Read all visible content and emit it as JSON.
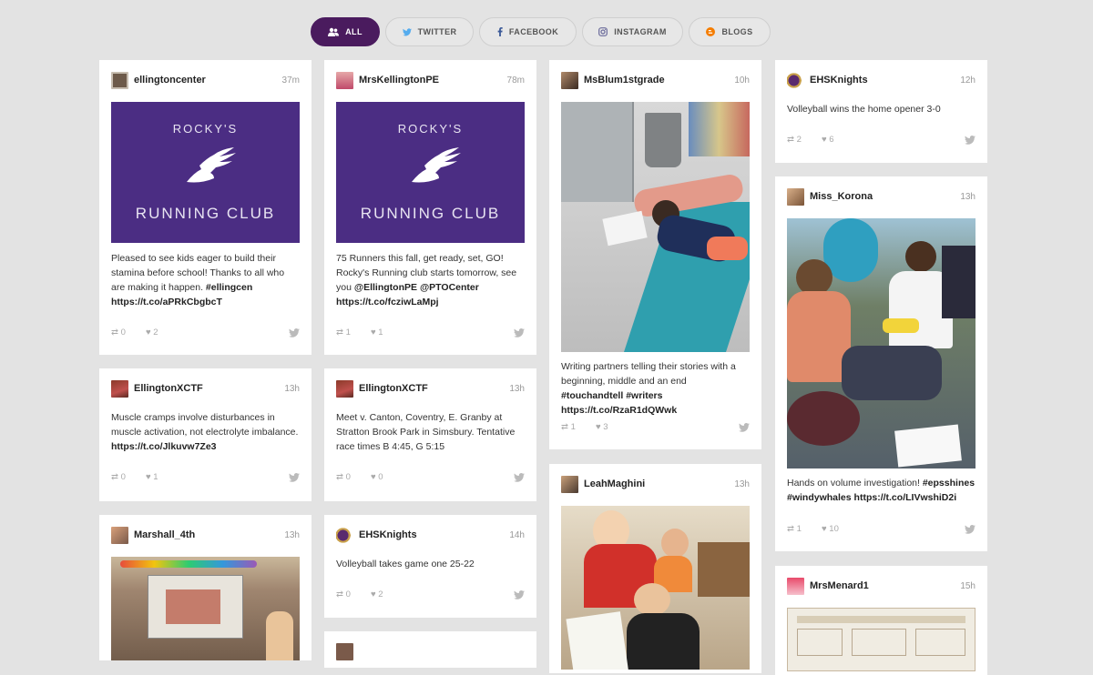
{
  "filters": [
    {
      "label": "ALL",
      "icon": "people-icon",
      "active": true
    },
    {
      "label": "TWITTER",
      "icon": "twitter-icon",
      "active": false
    },
    {
      "label": "FACEBOOK",
      "icon": "facebook-icon",
      "active": false
    },
    {
      "label": "INSTAGRAM",
      "icon": "instagram-icon",
      "active": false
    },
    {
      "label": "BLOGS",
      "icon": "blogger-icon",
      "active": false
    }
  ],
  "colors": {
    "accent": "#4a1b5e",
    "twitter": "#55acee",
    "facebook": "#3b5998",
    "blogger": "#f57d00",
    "instagram": "#6a6a9a"
  },
  "posts": [
    {
      "user": "ellingtoncenter",
      "time": "37m",
      "image_text": {
        "line1": "ROCKY'S",
        "line2": "RUNNING CLUB"
      },
      "text": "Pleased to see kids eager to build their stamina before school! Thanks to all who are making it happen. #ellingcen https://t.co/aPRkCbgbcT",
      "retweets": "0",
      "likes": "2"
    },
    {
      "user": "MrsKellingtonPE",
      "time": "78m",
      "image_text": {
        "line1": "ROCKY'S",
        "line2": "RUNNING CLUB"
      },
      "text": "75 Runners this fall, get ready, set, GO! Rocky's Running club starts tomorrow, see you @EllingtonPE @PTOCenter https://t.co/fcziwLaMpj",
      "retweets": "1",
      "likes": "1"
    },
    {
      "user": "MsBlum1stgrade",
      "time": "10h",
      "text": "Writing partners telling their stories with a beginning, middle and an end #touchandtell #writers https://t.co/RzaR1dQWwk",
      "retweets": "1",
      "likes": "3"
    },
    {
      "user": "EHSKnights",
      "time": "12h",
      "text": "Volleyball wins the home opener 3-0",
      "retweets": "2",
      "likes": "6"
    },
    {
      "user": "EllingtonXCTF",
      "time": "13h",
      "text": "Muscle cramps involve disturbances in muscle activation, not electrolyte imbalance. https://t.co/Jlkuvw7Ze3",
      "retweets": "0",
      "likes": "1"
    },
    {
      "user": "EllingtonXCTF",
      "time": "13h",
      "text": "Meet v. Canton, Coventry, E. Granby at Stratton Brook Park in Simsbury. Tentative race times B 4:45, G 5:15",
      "retweets": "0",
      "likes": "0"
    },
    {
      "user": "Miss_Korona",
      "time": "13h",
      "text": "Hands on volume investigation! #epsshines #windywhales https://t.co/LIVwshiD2i",
      "retweets": "1",
      "likes": "10"
    },
    {
      "user": "Marshall_4th",
      "time": "13h"
    },
    {
      "user": "EHSKnights",
      "time": "14h",
      "text": "Volleyball takes game one 25-22",
      "retweets": "0",
      "likes": "2"
    },
    {
      "user": "LeahMaghini",
      "time": "13h"
    },
    {
      "user": "MrsMenard1",
      "time": "15h"
    }
  ]
}
